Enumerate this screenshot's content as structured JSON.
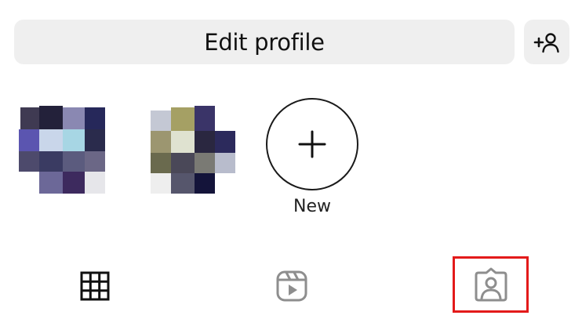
{
  "profile_actions": {
    "edit_profile_label": "Edit profile",
    "add_person_icon": "add-person-icon"
  },
  "highlights": {
    "items": [
      {
        "kind": "pixelated-thumbnail",
        "label": ""
      },
      {
        "kind": "pixelated-thumbnail",
        "label": ""
      }
    ],
    "new_label": "New",
    "new_icon": "plus-icon"
  },
  "tabs": [
    {
      "name": "grid",
      "icon": "grid-icon",
      "selected": true
    },
    {
      "name": "reels",
      "icon": "reels-icon",
      "selected": false
    },
    {
      "name": "tagged",
      "icon": "tagged-person-icon",
      "selected": false,
      "highlight_color": "#e31a1a"
    }
  ],
  "colors": {
    "button_bg": "#efefef",
    "text": "#111111",
    "highlight_box": "#e31a1a",
    "inactive_icon": "#8e8e8e"
  }
}
